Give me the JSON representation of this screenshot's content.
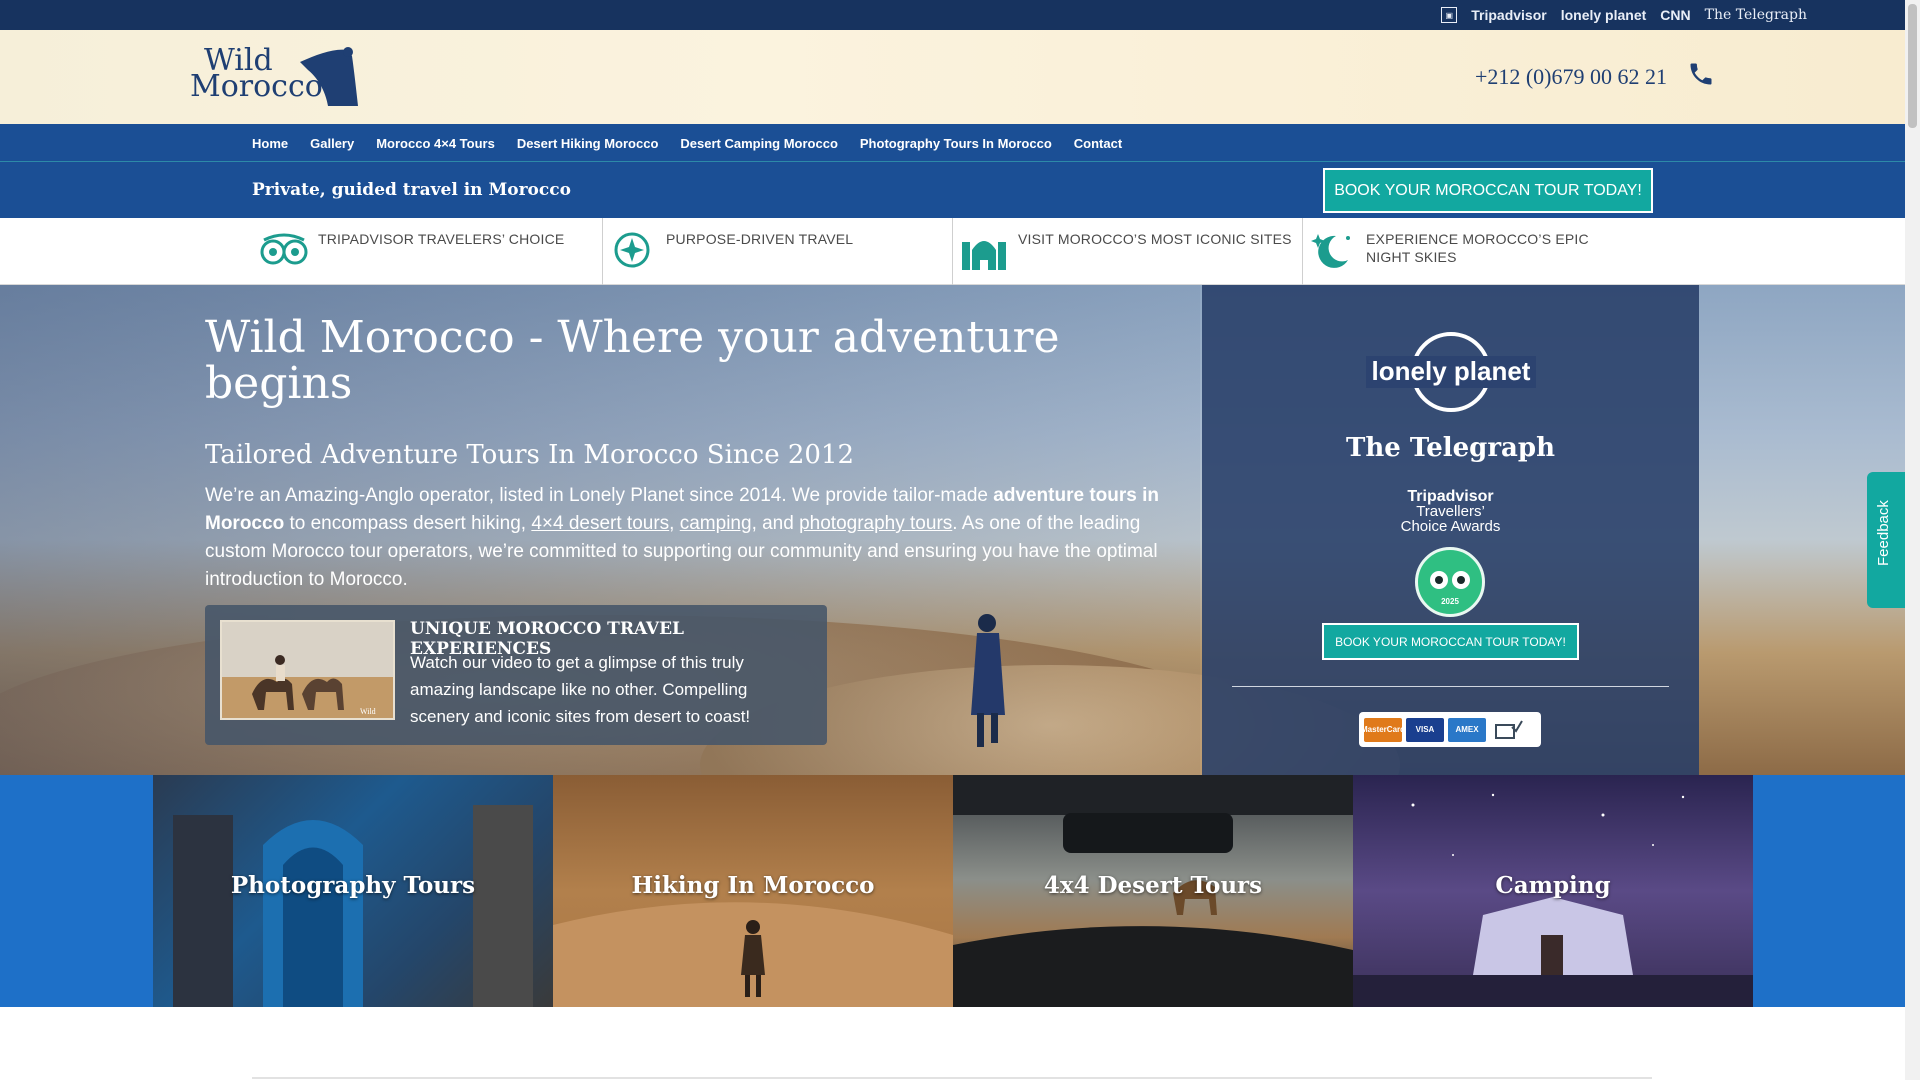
{
  "press": {
    "logos": [
      "Tripadvisor",
      "lonely planet",
      "CNN",
      "The Telegraph"
    ]
  },
  "header": {
    "logo_line1": "Wild",
    "logo_line2": "Morocco",
    "phone": "+212 (0)679 00 62 21"
  },
  "nav": {
    "items": [
      "Home",
      "Gallery",
      "Morocco 4×4 Tours",
      "Desert Hiking Morocco",
      "Desert Camping Morocco",
      "Photography Tours In Morocco",
      "Contact"
    ]
  },
  "subbar": {
    "tagline": "Private, guided travel in Morocco",
    "book_label": "BOOK YOUR MOROCCAN TOUR TODAY!"
  },
  "features": [
    {
      "label": "TRIPADVISOR TRAVELERS’ CHOICE",
      "icon": "tripadvisor-icon"
    },
    {
      "label": "PURPOSE-DRIVEN TRAVEL",
      "icon": "compass-icon"
    },
    {
      "label": "VISIT MOROCCO’S MOST ICONIC SITES",
      "icon": "mosque-icon"
    },
    {
      "label": "EXPERIENCE MOROCCO’S EPIC NIGHT SKIES",
      "icon": "night-sky-icon"
    }
  ],
  "hero": {
    "title": "Wild Morocco - Where your adventure begins",
    "subtitle": "Tailored Adventure Tours In Morocco Since 2012",
    "body": {
      "p1": "We’re an Amazing-Anglo operator, listed in Lonely Planet since 2014. We provide tailor-made ",
      "bold": "adventure tours in Morocco",
      "p2": " to encompass desert hiking, ",
      "link1": "4×4 desert tours",
      "sep1": ", ",
      "link2": "camping",
      "sep2": ", and ",
      "link3": "photography tours",
      "p3": ". As one of the leading custom Morocco tour operators, we’re committed to supporting our community and ensuring you have the optimal introduction to Morocco."
    },
    "video": {
      "title": "UNIQUE MOROCCO TRAVEL EXPERIENCES",
      "description": "Watch our video to get a glimpse of this truly amazing landscape like no other. Compelling scenery and iconic sites from desert to coast!"
    }
  },
  "awards": {
    "lonely_planet": "lonely planet",
    "telegraph": "The Telegraph",
    "tripadvisor_line1": "Tripadvisor",
    "tripadvisor_line2": "Travellers’",
    "tripadvisor_line3": "Choice Awards",
    "badge_year": "2025",
    "book_label": "BOOK YOUR MOROCCAN TOUR TODAY!",
    "cards": [
      "MasterCard",
      "VISA",
      "AMEX"
    ]
  },
  "feedback_label": "Feedback",
  "tiles": [
    {
      "label": "Photography Tours"
    },
    {
      "label": "Hiking In Morocco"
    },
    {
      "label": "4x4 Desert Tours"
    },
    {
      "label": "Camping"
    }
  ],
  "colors": {
    "navy": "#17335f",
    "nav_blue": "#1b4f95",
    "teal": "#12a8a0",
    "tile_blue": "#1e70c8"
  }
}
